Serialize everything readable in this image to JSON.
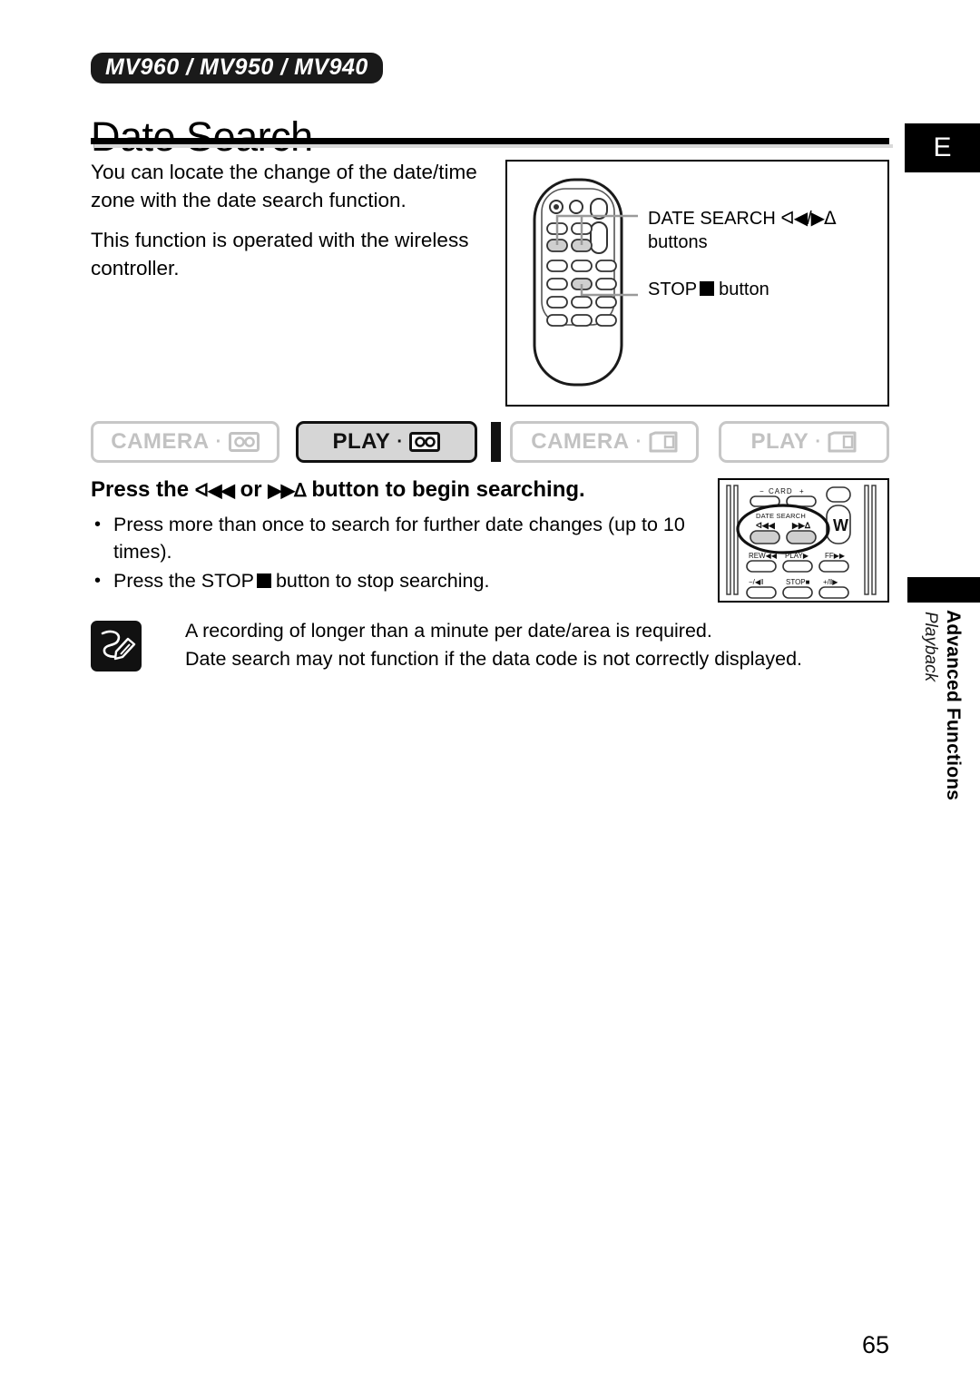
{
  "header": {
    "model_badge": "MV960 / MV950 / MV940",
    "title": "Date Search",
    "language_tab": "E"
  },
  "intro": {
    "paragraph_1": "You can locate the change of the date/time zone with the date search function.",
    "paragraph_2": "This function is operated with the wireless controller."
  },
  "remote_figure": {
    "callout_date_search_label": "DATE SEARCH",
    "callout_date_search_glyphs": "ᐊ◀/▶ᐃ",
    "callout_date_search_sub": "buttons",
    "callout_stop_label": "STOP",
    "callout_stop_suffix": "button"
  },
  "modes": [
    {
      "label": "CAMERA",
      "separator": "·",
      "media": "tape",
      "active": false,
      "name": "camera-tape"
    },
    {
      "label": "PLAY",
      "separator": "·",
      "media": "tape",
      "active": true,
      "name": "play-tape"
    },
    {
      "label": "CAMERA",
      "separator": "·",
      "media": "card",
      "active": false,
      "name": "camera-card"
    },
    {
      "label": "PLAY",
      "separator": "·",
      "media": "card",
      "active": false,
      "name": "play-card"
    }
  ],
  "instruction": {
    "heading_part_1": "Press the",
    "heading_glyph_rew": "ᐊ◀◀",
    "heading_part_2": "or",
    "heading_glyph_ff": "▶▶ᐃ",
    "heading_part_3": "button to begin searching.",
    "bullets": [
      "Press more than once to search for further date changes (up to 10 times).",
      "Press the STOP ■ button to stop searching."
    ],
    "bullet_2_pre": "Press the STOP",
    "bullet_2_post": "button to stop searching."
  },
  "camcorder_panel": {
    "card_label": "CARD",
    "card_minus": "−",
    "card_plus": "+",
    "date_search_label": "DATE SEARCH",
    "rew_glyph": "ᐊ◀◀",
    "ff_glyph": "▶▶ᐃ",
    "zoom_label": "W",
    "rew_label": "REW◀◀",
    "play_label": "PLAY▶",
    "ff_label": "FF▶▶",
    "slow_rev_label": "−/◀‖",
    "stop_label": "STOP■",
    "slow_fwd_label": "+/‖▶"
  },
  "note": {
    "line_1": "A recording of longer than a minute per date/area is required.",
    "line_2": "Date search may not function if the data code is not correctly displayed."
  },
  "side_tab": {
    "section": "Advanced Functions",
    "subsection": "Playback"
  },
  "footer": {
    "page_number": "65"
  },
  "colors": {
    "ink": "#000000",
    "inactive_gray": "#c2c2c2",
    "active_fill": "#d6d6d6",
    "rule_shadow": "#d9d9d9"
  }
}
